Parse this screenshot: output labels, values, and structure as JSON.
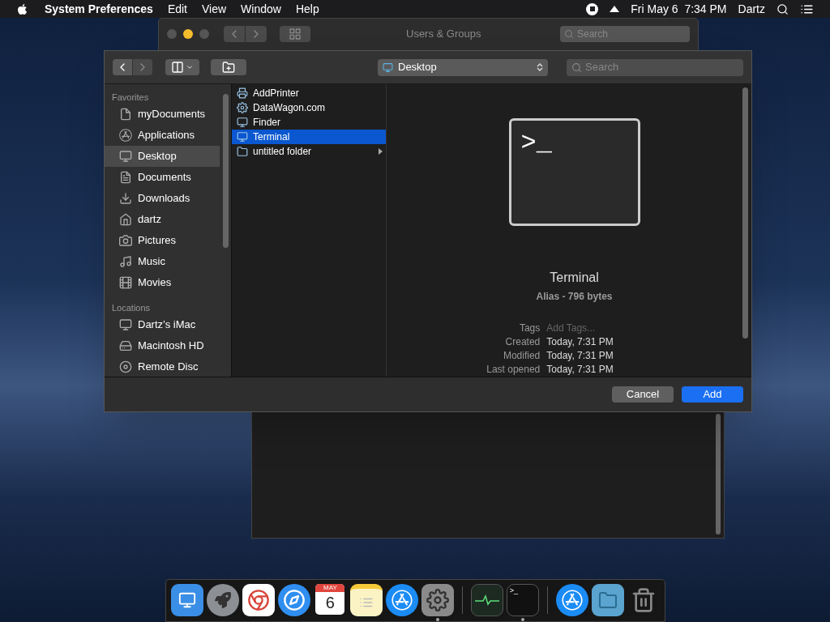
{
  "menubar": {
    "app_name": "System Preferences",
    "menus": [
      "Edit",
      "View",
      "Window",
      "Help"
    ],
    "date_time": "Fri May 6  7:34 PM",
    "user": "Dartz"
  },
  "back_window": {
    "title": "Users & Groups",
    "search_placeholder": "Search"
  },
  "dialog": {
    "location": "Desktop",
    "search_placeholder": "Search",
    "sidebar": [
      {
        "title": "Favorites",
        "items": [
          {
            "label": "myDocuments",
            "selected": false
          },
          {
            "label": "Applications",
            "selected": false
          },
          {
            "label": "Desktop",
            "selected": true
          },
          {
            "label": "Documents",
            "selected": false
          },
          {
            "label": "Downloads",
            "selected": false
          },
          {
            "label": "dartz",
            "selected": false
          },
          {
            "label": "Pictures",
            "selected": false
          },
          {
            "label": "Music",
            "selected": false
          },
          {
            "label": "Movies",
            "selected": false
          }
        ]
      },
      {
        "title": "Locations",
        "items": [
          {
            "label": "Dartz’s iMac",
            "selected": false
          },
          {
            "label": "Macintosh HD",
            "selected": false
          },
          {
            "label": "Remote Disc",
            "selected": false
          }
        ]
      }
    ],
    "files": [
      {
        "name": "AddPrinter",
        "selected": false,
        "expandable": false
      },
      {
        "name": "DataWagon.com",
        "selected": false,
        "expandable": false
      },
      {
        "name": "Finder",
        "selected": false,
        "expandable": false
      },
      {
        "name": "Terminal",
        "selected": true,
        "expandable": false
      },
      {
        "name": "untitled folder",
        "selected": false,
        "expandable": true
      }
    ],
    "preview": {
      "prompt": ">_",
      "name": "Terminal",
      "kind_size": "Alias - 796 bytes",
      "info": [
        {
          "label": "Tags",
          "placeholder": "Add Tags..."
        },
        {
          "label": "Created",
          "value": "Today, 7:31 PM"
        },
        {
          "label": "Modified",
          "value": "Today, 7:31 PM"
        },
        {
          "label": "Last opened",
          "value": "Today, 7:31 PM"
        }
      ]
    },
    "buttons": [
      {
        "label": "Cancel",
        "kind": "normal"
      },
      {
        "label": "Add",
        "kind": "default"
      }
    ]
  },
  "dock": {
    "items": [
      {
        "running": false
      },
      {
        "running": false
      },
      {
        "running": false
      },
      {
        "running": false
      },
      {
        "running": false,
        "month": "MAY",
        "day": "6"
      },
      {
        "running": false
      },
      {
        "running": false
      },
      {
        "running": true
      },
      {
        "running": false
      },
      {
        "running": true
      },
      {
        "running": false
      },
      {
        "running": false
      },
      {
        "running": false
      }
    ]
  }
}
